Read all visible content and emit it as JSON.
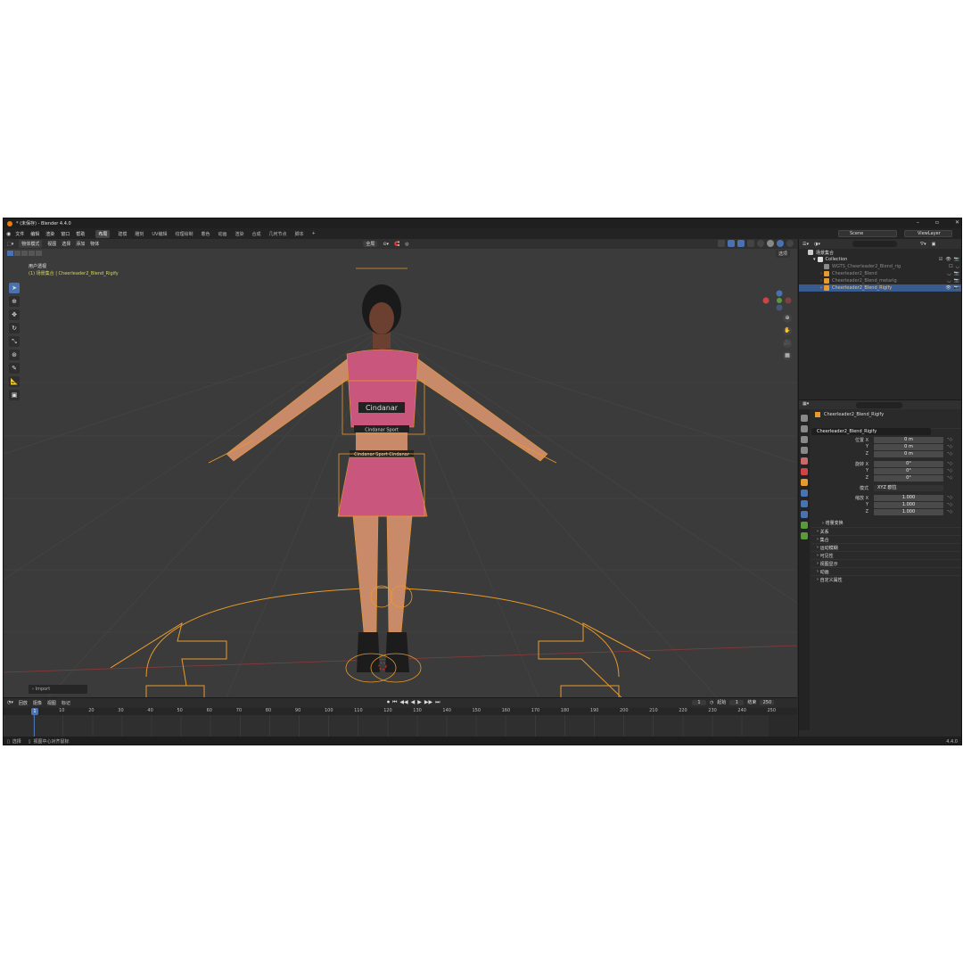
{
  "title": "* (未保存) - Blender 4.4.0",
  "menu": [
    "文件",
    "编辑",
    "渲染",
    "窗口",
    "帮助"
  ],
  "workspaces": [
    "布局",
    "建模",
    "雕刻",
    "UV编辑",
    "纹理绘制",
    "着色",
    "动画",
    "渲染",
    "合成",
    "几何节点",
    "脚本",
    "+"
  ],
  "scene": "Scene",
  "view_layer": "ViewLayer",
  "viewport": {
    "mode": "物体模式",
    "header_menus": [
      "视图",
      "选择",
      "添加",
      "物体"
    ],
    "transform_orient": "全局",
    "options": "选项",
    "view_name": "用户透视",
    "view_sub": "(1) 场景集合 | Cheerleader2_Blend_Rigify",
    "import_label": "Import",
    "shirt_text": "Cindanar",
    "band_text1": "Cindanar Sport",
    "band_text2": "Cindanar Sport   Cindanar"
  },
  "timeline": {
    "menus": [
      "回放",
      "抠像",
      "视图",
      "标记"
    ],
    "current": "1",
    "start_label": "起始",
    "start": "1",
    "end_label": "结束",
    "end": "250",
    "ticks": [
      "10",
      "20",
      "30",
      "40",
      "50",
      "60",
      "70",
      "80",
      "90",
      "100",
      "110",
      "120",
      "130",
      "140",
      "150",
      "160",
      "170",
      "180",
      "190",
      "200",
      "210",
      "220",
      "230",
      "240",
      "250"
    ]
  },
  "status": {
    "left": "选择",
    "hint": "视图中心对齐鼠标",
    "version": "4.4.0"
  },
  "outliner": {
    "search": "",
    "root": "场景集合",
    "collection": "Collection",
    "items": [
      {
        "name": "WGTS_Cheerleader2_Blend_rig",
        "dim": true,
        "selected": false
      },
      {
        "name": "Cheerleader2_Blend",
        "dim": true,
        "selected": false
      },
      {
        "name": "Cheerleader2_Blend_metarig",
        "dim": true,
        "selected": false
      },
      {
        "name": "Cheerleader2_Blend_Rigify",
        "dim": false,
        "selected": true
      }
    ]
  },
  "properties": {
    "search": "",
    "object_name": "Cheerleader2_Blend_Rigify",
    "name_field": "Cheerleader2_Blend_Rigify",
    "section_transform": "变换",
    "location_label": "位置 X",
    "rotation_label": "旋转 X",
    "scale_label": "缩放 X",
    "axis_y": "Y",
    "axis_z": "Z",
    "loc": [
      "0 m",
      "0 m",
      "0 m"
    ],
    "rot": [
      "0°",
      "0°",
      "0°"
    ],
    "mode_label": "模式",
    "mode_value": "XYZ 欧拉",
    "scale": [
      "1.000",
      "1.000",
      "1.000"
    ],
    "delta": "增量变换",
    "sections": [
      "关系",
      "集合",
      "运动模糊",
      "可见性",
      "视图显示",
      "自定义属性",
      "动画"
    ]
  },
  "colors": {
    "accent": "#4b72b0",
    "wire": "#e89a2c",
    "selected_row": "#3a5b8f"
  }
}
